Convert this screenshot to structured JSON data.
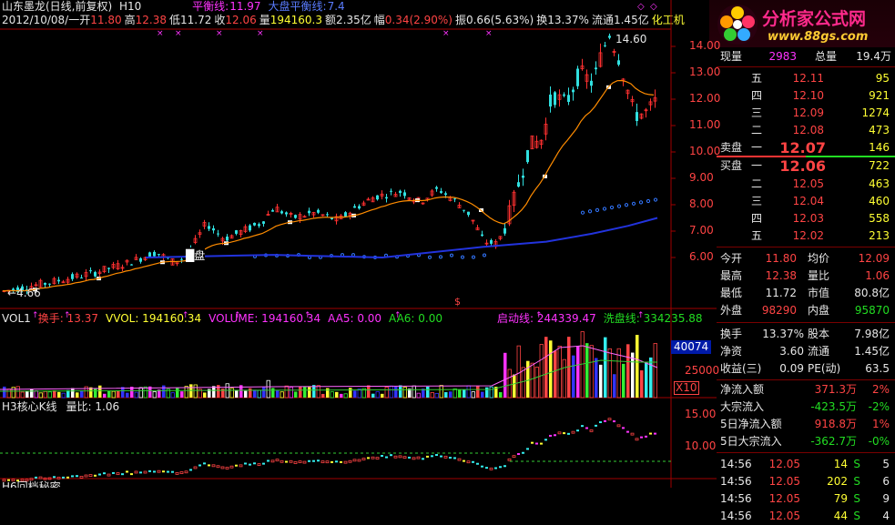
{
  "header": {
    "line1": {
      "title": "山东墨龙(日线,前复权)",
      "indicator": "H10",
      "lines": [
        {
          "label": "平衡线:",
          "value": "11.97",
          "color": "#ff33ff"
        },
        {
          "label": "大盘平衡线:",
          "value": "7.4",
          "color": "#5a7cff"
        }
      ]
    },
    "line2": {
      "date": "2012/10/08/一",
      "items": [
        {
          "label": "开",
          "value": "11.80",
          "color": "#ff4444"
        },
        {
          "label": "高",
          "value": "12.38",
          "color": "#ff4444"
        },
        {
          "label": "低",
          "value": "11.72",
          "color": "#e6e6e6"
        },
        {
          "label": "收",
          "value": "12.06",
          "color": "#ff4444"
        },
        {
          "label": "量",
          "value": "194160.3",
          "color": "#ffff33"
        },
        {
          "label": "额",
          "value": "2.35亿",
          "color": "#e6e6e6"
        },
        {
          "label": "幅",
          "value": "0.34(2.90%)",
          "color": "#ff4444"
        },
        {
          "label": "振",
          "value": "0.66(5.63%)",
          "color": "#e6e6e6"
        },
        {
          "label": "换",
          "value": "13.37%",
          "color": "#e6e6e6"
        },
        {
          "label": "流通",
          "value": "1.45亿",
          "color": "#e6e6e6"
        },
        {
          "label": "",
          "value": "化工机",
          "color": "#ffff33"
        }
      ]
    }
  },
  "logo": {
    "name": "分析家公式网",
    "url": "www.88gs.com"
  },
  "main_chart": {
    "high_marker": "14.60",
    "low_marker": "4.66",
    "axis_ticks": [
      "14.00",
      "13.00",
      "12.00",
      "11.00",
      "10.00",
      "9.00",
      "8.00",
      "7.00",
      "6.00"
    ]
  },
  "vol_panel": {
    "items": [
      {
        "label": "VOL1",
        "color": "#e6e6e6"
      },
      {
        "label": "换手: 13.37",
        "color": "#ff4444"
      },
      {
        "label": "VVOL: 194160.34",
        "color": "#ffff33"
      },
      {
        "label": "VOLUME: 194160.34",
        "color": "#ff33ff"
      },
      {
        "label": "AA5: 0.00",
        "color": "#ff33ff"
      },
      {
        "label": "AA6: 0.00",
        "color": "#22dd22"
      },
      {
        "label": "启动线: 244339.47",
        "color": "#ff33ff"
      },
      {
        "label": "洗盘线: 334235.88",
        "color": "#22dd22"
      }
    ],
    "axis_current": "40074",
    "axis_ticks": [
      "25000"
    ],
    "unit": "X10"
  },
  "h3_panel": {
    "items": [
      {
        "label": "H3核心K线",
        "color": "#e6e6e6"
      },
      {
        "label": "量比: 1.06",
        "color": "#e6e6e6"
      }
    ],
    "axis_ticks": [
      "15.00",
      "10.00"
    ],
    "bottom_clip": "H6回档秘密"
  },
  "quote": {
    "xianliang": {
      "label": "现量",
      "value": "2983",
      "total_label": "总量",
      "total": "19.4万"
    },
    "asks": [
      {
        "lvl": "五",
        "price": "12.11",
        "vol": "95"
      },
      {
        "lvl": "四",
        "price": "12.10",
        "vol": "921"
      },
      {
        "lvl": "三",
        "price": "12.09",
        "vol": "1274"
      },
      {
        "lvl": "二",
        "price": "12.08",
        "vol": "473"
      },
      {
        "lvl": "一",
        "price": "12.07",
        "vol": "146",
        "side": "卖盘"
      }
    ],
    "bids": [
      {
        "lvl": "一",
        "price": "12.06",
        "vol": "722",
        "side": "买盘"
      },
      {
        "lvl": "二",
        "price": "12.05",
        "vol": "463"
      },
      {
        "lvl": "三",
        "price": "12.04",
        "vol": "460"
      },
      {
        "lvl": "四",
        "price": "12.03",
        "vol": "558"
      },
      {
        "lvl": "五",
        "price": "12.02",
        "vol": "213"
      }
    ],
    "stats": [
      {
        "l1": "今开",
        "v1": "11.80",
        "c1": "#ff4444",
        "l2": "均价",
        "v2": "12.09",
        "c2": "#ff4444"
      },
      {
        "l1": "最高",
        "v1": "12.38",
        "c1": "#ff4444",
        "l2": "量比",
        "v2": "1.06",
        "c2": "#ff4444"
      },
      {
        "l1": "最低",
        "v1": "11.72",
        "c1": "#e6e6e6",
        "l2": "市值",
        "v2": "80.8亿",
        "c2": "#e6e6e6"
      },
      {
        "l1": "外盘",
        "v1": "98290",
        "c1": "#ff4444",
        "l2": "内盘",
        "v2": "95870",
        "c2": "#22dd22"
      }
    ],
    "stats2": [
      {
        "l1": "换手",
        "v1": "13.37%",
        "l2": "股本",
        "v2": "7.98亿"
      },
      {
        "l1": "净资",
        "v1": "3.60",
        "l2": "流通",
        "v2": "1.45亿"
      },
      {
        "l1": "收益(三)",
        "v1": "0.09",
        "l2": "PE(动)",
        "v2": "63.5"
      }
    ],
    "flows": [
      {
        "label": "净流入额",
        "value": "371.3万",
        "pct": "2%",
        "color": "#ff4444"
      },
      {
        "label": "大宗流入",
        "value": "-423.5万",
        "pct": "-2%",
        "color": "#22dd22"
      },
      {
        "label": "5日净流入额",
        "value": "918.8万",
        "pct": "1%",
        "color": "#ff4444"
      },
      {
        "label": "5日大宗流入",
        "value": "-362.7万",
        "pct": "-0%",
        "color": "#22dd22"
      }
    ],
    "ticks": [
      {
        "time": "14:56",
        "price": "12.05",
        "vol": "14",
        "bs": "S",
        "num": "5"
      },
      {
        "time": "14:56",
        "price": "12.05",
        "vol": "202",
        "bs": "S",
        "num": "6"
      },
      {
        "time": "14:56",
        "price": "12.05",
        "vol": "79",
        "bs": "S",
        "num": "9"
      },
      {
        "time": "14:56",
        "price": "12.05",
        "vol": "44",
        "bs": "S",
        "num": "4"
      }
    ]
  }
}
